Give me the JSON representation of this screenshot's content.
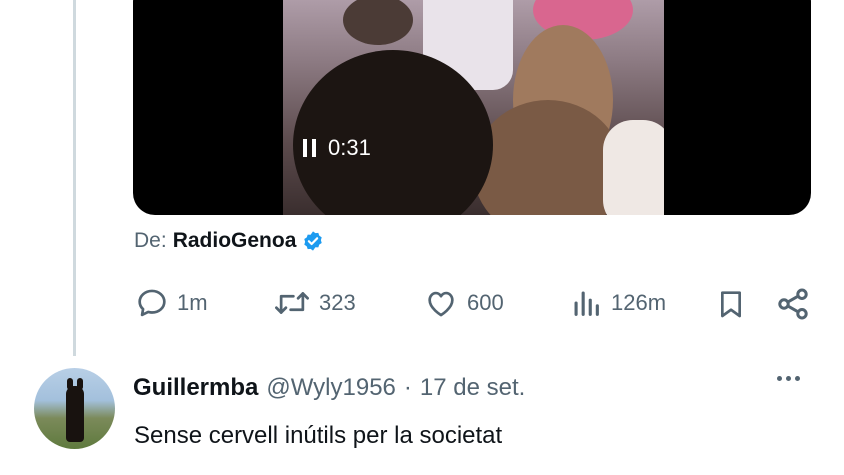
{
  "video": {
    "elapsed": "0:31"
  },
  "source": {
    "prefix": "De:",
    "name": "RadioGenoa"
  },
  "actions": {
    "replies": "1m",
    "reposts": "323",
    "likes": "600",
    "views": "126m"
  },
  "reply": {
    "name": "Guillermba",
    "handle": "@Wyly1956",
    "separator": "·",
    "date": "17 de set.",
    "text": "Sense cervell inútils per la societat"
  },
  "colors": {
    "verified": "#1d9bf0",
    "muted": "#536471",
    "text": "#0f1419"
  },
  "icons": [
    "pause-icon",
    "verified-badge-icon",
    "reply-icon",
    "repost-icon",
    "like-icon",
    "views-icon",
    "bookmark-icon",
    "share-icon",
    "more-icon"
  ]
}
